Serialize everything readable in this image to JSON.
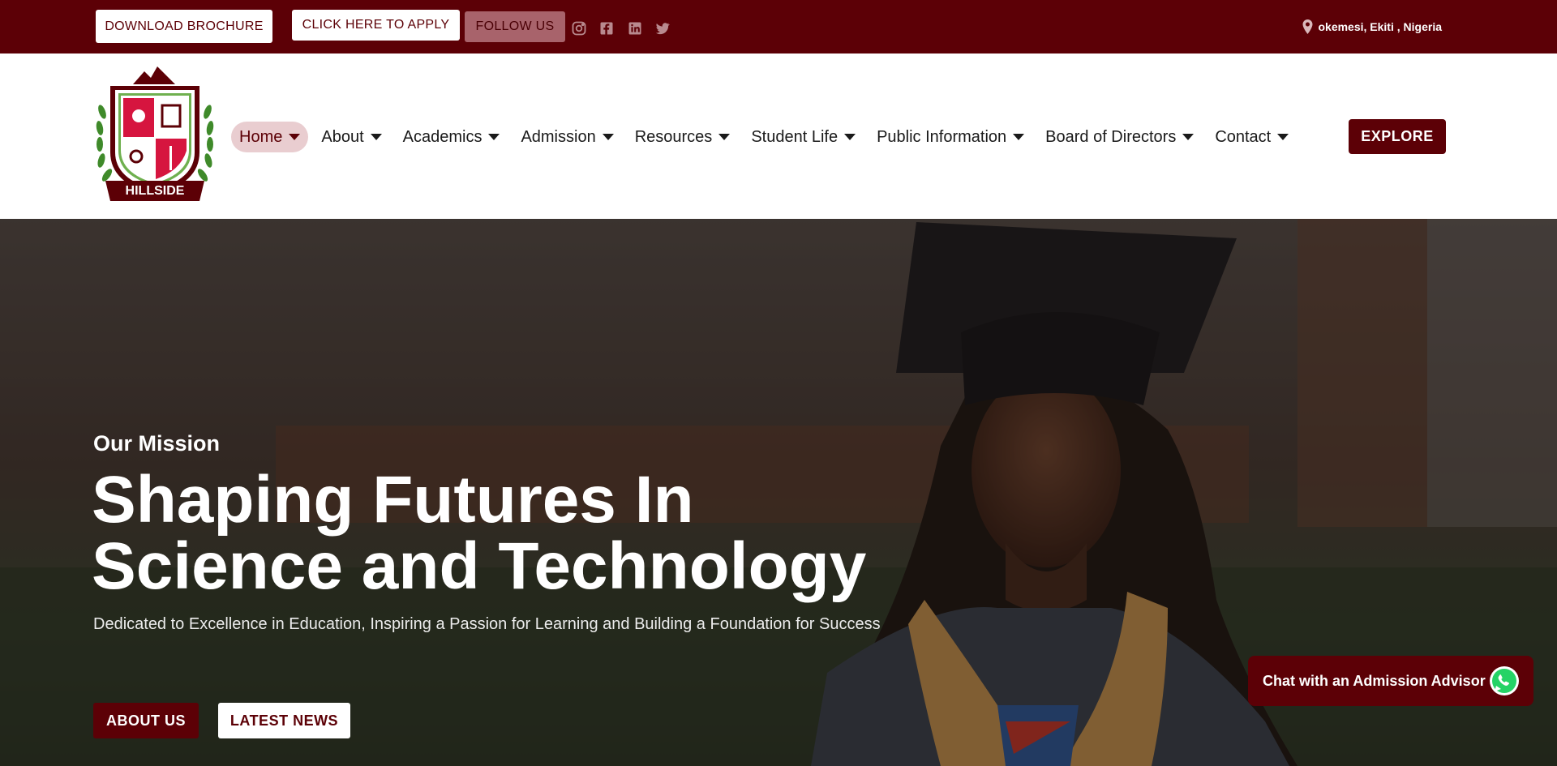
{
  "topbar": {
    "brochure_label": "DOWNLOAD BROCHURE",
    "apply_label": "CLICK HERE TO APPLY",
    "follow_label": "FOLLOW US",
    "social_icons": [
      "instagram-icon",
      "facebook-icon",
      "linkedin-icon",
      "twitter-icon"
    ],
    "location": "okemesi, Ekiti , Nigeria"
  },
  "header": {
    "logo_text": "HILLSIDE",
    "nav": [
      {
        "label": "Home",
        "active": true
      },
      {
        "label": "About"
      },
      {
        "label": "Academics"
      },
      {
        "label": "Admission"
      },
      {
        "label": "Resources"
      },
      {
        "label": "Student Life"
      },
      {
        "label": "Public Information"
      },
      {
        "label": "Board of Directors"
      },
      {
        "label": "Contact"
      }
    ],
    "explore_label": "EXPLORE"
  },
  "hero": {
    "eyebrow": "Our Mission",
    "headline_line1": "Shaping Futures In",
    "headline_line2": "Science and Technology",
    "subtext": "Dedicated to Excellence in Education, Inspiring a Passion for Learning and Building a Foundation for Success",
    "about_label": "ABOUT US",
    "news_label": "LATEST NEWS"
  },
  "chat": {
    "label": "Chat with an Admission Advisor"
  },
  "colors": {
    "brand": "#5c0006",
    "nav_active_bg": "#e9cdd0",
    "follow_bg": "#a8636b"
  }
}
